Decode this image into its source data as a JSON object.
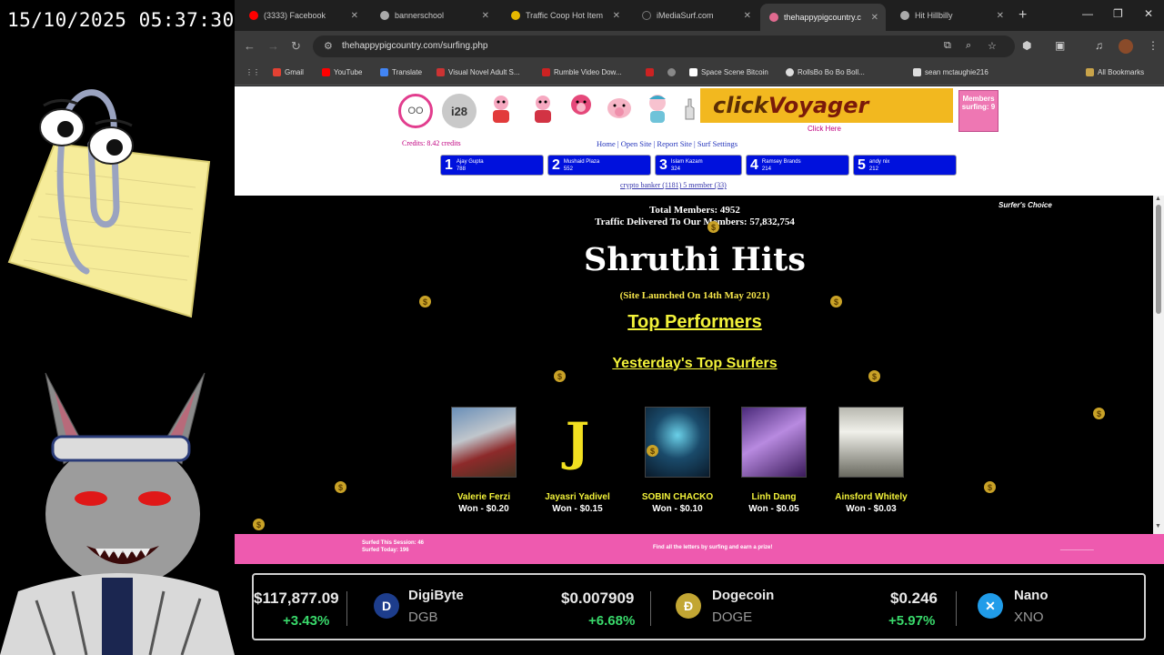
{
  "clock": "15/10/2025 05:37:30",
  "browser": {
    "tabs": [
      {
        "label": "(3333) Facebook",
        "active": false,
        "color": "#ff0000"
      },
      {
        "label": "bannerschool",
        "active": false,
        "color": "#aaaaaa"
      },
      {
        "label": "Traffic Coop Hot Item",
        "active": false,
        "color": "#e6b800"
      },
      {
        "label": "iMediaSurf.com",
        "active": false,
        "color": "#222222"
      },
      {
        "label": "thehappypigcountry.c",
        "active": true,
        "color": "#e06a8f"
      },
      {
        "label": "Hit Hillbilly",
        "active": false,
        "color": "#aaaaaa"
      }
    ],
    "url": "thehappypigcountry.com/surfing.php",
    "bookmarks": [
      {
        "label": "Gmail",
        "color": "#e34133"
      },
      {
        "label": "YouTube",
        "color": "#ff0000"
      },
      {
        "label": "Translate",
        "color": "#4285f4"
      },
      {
        "label": "Visual Novel Adult S...",
        "color": "#cc3333"
      },
      {
        "label": "Rumble Video Dow...",
        "color": "#cc2222"
      },
      {
        "label": "",
        "color": "#cc2222"
      },
      {
        "label": "",
        "color": "#888888"
      },
      {
        "label": "Space Scene Bitcoin",
        "color": "#ffffff"
      },
      {
        "label": "RollsBo Bo Bo Boll...",
        "color": "#dddddd"
      },
      {
        "label": "sean mctaughie216",
        "color": "#dddddd"
      }
    ],
    "all_bookmarks": "All Bookmarks"
  },
  "page": {
    "header": {
      "circles": [
        "OO",
        "i28"
      ],
      "ad_title_a": "click",
      "ad_title_b": "Voyager",
      "click_here": "Click Here",
      "members_box": "Members surfing: 9",
      "credits": "Credits: 8.42 credits",
      "nav": "Home | Open Site | Report Site | Surf Settings",
      "banner_line": "crypto banker (1181) 5 member (33)"
    },
    "rankings": [
      {
        "num": "1",
        "name": "Ajay Gupta",
        "score": "788"
      },
      {
        "num": "2",
        "name": "Mushaid Plaza",
        "score": "552"
      },
      {
        "num": "3",
        "name": "Islam Kazam",
        "score": "324"
      },
      {
        "num": "4",
        "name": "Ramsey Brands",
        "score": "214"
      },
      {
        "num": "5",
        "name": "andy nix",
        "score": "212"
      }
    ],
    "stats_members": "Total Members: 4952",
    "stats_traffic": "Traffic Delivered To Our Members: 57,832,754",
    "surfs_choice": "Surfer's Choice",
    "site_title": "Shruthi Hits",
    "launched": "(Site Launched On 14th May 2021)",
    "top_performers": "Top Performers",
    "yesterday_title": "Yesterday's Top Surfers",
    "surfers": [
      {
        "name": "Valerie Ferzi",
        "won": "Won - $0.20"
      },
      {
        "name": "Jayasri Yadivel",
        "won": "Won - $0.15"
      },
      {
        "name": "SOBIN CHACKO",
        "won": "Won - $0.10"
      },
      {
        "name": "Linh Dang",
        "won": "Won - $0.05"
      },
      {
        "name": "Ainsford Whitely",
        "won": "Won - $0.03"
      }
    ],
    "coin_symbol": "$",
    "pink_bar": {
      "left_line1": "Surfed This Session: 46",
      "left_line2": "Surfed Today: 196",
      "center": "Find all the letters by surfing and earn a prize!",
      "right": "___________"
    }
  },
  "ticker": [
    {
      "price": "$117,877.09",
      "change": "+3.43%"
    },
    {
      "name": "DigiByte",
      "symbol": "DGB",
      "price": "$0.007909",
      "change": "+6.68%"
    },
    {
      "name": "Dogecoin",
      "symbol": "DOGE",
      "price": "$0.246",
      "change": "+5.97%"
    },
    {
      "name": "Nano",
      "symbol": "XNO"
    }
  ]
}
